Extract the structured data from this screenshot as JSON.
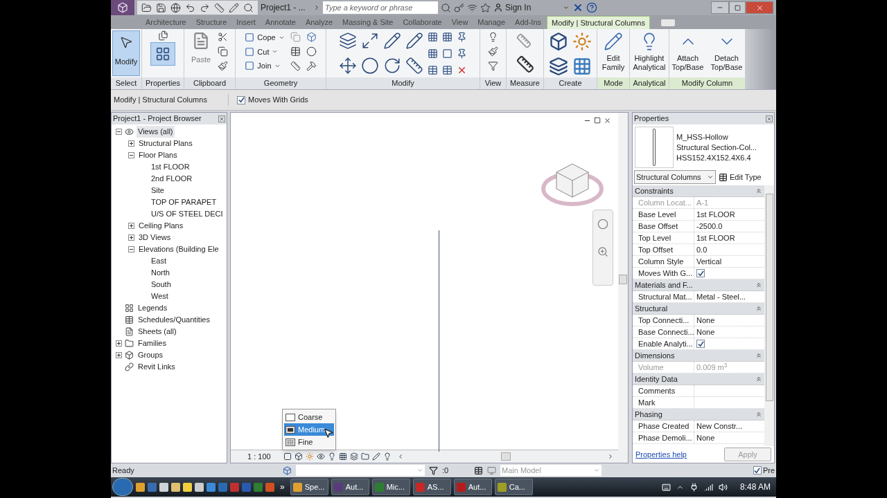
{
  "title_bar": {
    "title": "Project1 - ...",
    "search": {
      "placeholder": "Type a keyword or phrase"
    },
    "sign_in": "Sign In"
  },
  "ribbon_tabs": [
    {
      "label": "Architecture",
      "selected": false
    },
    {
      "label": "Structure",
      "selected": false
    },
    {
      "label": "Insert",
      "selected": false
    },
    {
      "label": "Annotate",
      "selected": false
    },
    {
      "label": "Analyze",
      "selected": false
    },
    {
      "label": "Massing & Site",
      "selected": false
    },
    {
      "label": "Collaborate",
      "selected": false
    },
    {
      "label": "View",
      "selected": false
    },
    {
      "label": "Manage",
      "selected": false
    },
    {
      "label": "Add-Ins",
      "selected": false
    },
    {
      "label": "Modify | Structural Columns",
      "selected": true
    }
  ],
  "ribbon_panels": [
    {
      "kind": "select",
      "label": "Select",
      "contextual": false,
      "buttons": [
        {
          "label": "Modify",
          "selected": true
        }
      ]
    },
    {
      "kind": "properties",
      "label": "Properties",
      "contextual": false,
      "active": true
    },
    {
      "kind": "clipboard",
      "label": "Clipboard",
      "contextual": false,
      "buttons": [
        {
          "label": "Paste",
          "disabled": true
        }
      ]
    },
    {
      "kind": "geometry",
      "label": "Geometry",
      "contextual": false,
      "buttons": [
        {
          "label": "Cope"
        },
        {
          "label": "Cut"
        },
        {
          "label": "Join"
        }
      ]
    },
    {
      "kind": "modify",
      "label": "Modify",
      "contextual": false
    },
    {
      "kind": "view",
      "label": "View",
      "contextual": false
    },
    {
      "kind": "measure",
      "label": "Measure",
      "contextual": false
    },
    {
      "kind": "create",
      "label": "Create",
      "contextual": false
    },
    {
      "kind": "large",
      "label": "Mode",
      "contextual": true,
      "buttons": [
        {
          "label": "Edit Family"
        }
      ]
    },
    {
      "kind": "large",
      "label": "Analytical",
      "contextual": true,
      "buttons": [
        {
          "label": "Highlight Analytical"
        }
      ]
    },
    {
      "kind": "large",
      "label": "Modify Column",
      "contextual": true,
      "buttons": [
        {
          "label": "Attach Top/Base"
        },
        {
          "label": "Detach Top/Base"
        }
      ]
    }
  ],
  "options_bar": {
    "context": "Modify | Structural Columns",
    "moves_with_grids": {
      "label": "Moves With Grids",
      "checked": true
    }
  },
  "project_browser": {
    "title": "Project1 - Project Browser",
    "tree": [
      {
        "label": "Views (all)",
        "kind": "views",
        "expanded": true,
        "selected": true,
        "children": [
          {
            "label": "Structural Plans",
            "expanded": false,
            "selected": false
          },
          {
            "label": "Floor Plans",
            "expanded": true,
            "selected": false,
            "children": [
              {
                "label": "1st FLOOR",
                "selected": false
              },
              {
                "label": "2nd FLOOR",
                "selected": false
              },
              {
                "label": "Site",
                "selected": false
              },
              {
                "label": "TOP OF PARAPET",
                "selected": false
              },
              {
                "label": "U/S OF STEEL DECI",
                "selected": false
              }
            ]
          },
          {
            "label": "Ceiling Plans",
            "expanded": false,
            "selected": false
          },
          {
            "label": "3D Views",
            "expanded": false,
            "selected": false
          },
          {
            "label": "Elevations (Building Ele",
            "expanded": true,
            "selected": false,
            "children": [
              {
                "label": "East",
                "selected": false
              },
              {
                "label": "North",
                "selected": false
              },
              {
                "label": "South",
                "selected": false
              },
              {
                "label": "West",
                "selected": false
              }
            ]
          }
        ]
      },
      {
        "label": "Legends",
        "kind": "legends",
        "selected": false
      },
      {
        "label": "Schedules/Quantities",
        "kind": "schedules",
        "selected": false
      },
      {
        "label": "Sheets (all)",
        "kind": "sheets",
        "selected": false
      },
      {
        "label": "Families",
        "kind": "families",
        "expanded": false,
        "selected": false
      },
      {
        "label": "Groups",
        "kind": "groups",
        "expanded": false,
        "selected": false
      },
      {
        "label": "Revit Links",
        "kind": "links",
        "selected": false
      }
    ]
  },
  "view": {
    "scale": "1 : 100",
    "detail_menu": [
      {
        "label": "Coarse",
        "kind": "coarse",
        "selected": false
      },
      {
        "label": "Medium",
        "kind": "medium",
        "selected": true
      },
      {
        "label": "Fine",
        "kind": "fine",
        "selected": false
      }
    ]
  },
  "properties": {
    "title": "Properties",
    "type_lines": [
      "M_HSS-Hollow",
      "Structural Section-Col...",
      "HSS152.4X152.4X6.4"
    ],
    "category": "Structural Columns",
    "edit_type": "Edit Type",
    "groups": [
      {
        "name": "Constraints",
        "rows": [
          {
            "label": "Column Locat...",
            "value": "A-1",
            "kind": "text",
            "readonly": true
          },
          {
            "label": "Base Level",
            "value": "1st FLOOR",
            "kind": "text",
            "readonly": false
          },
          {
            "label": "Base Offset",
            "value": "-2500.0",
            "kind": "text",
            "readonly": false
          },
          {
            "label": "Top Level",
            "value": "1st FLOOR",
            "kind": "text",
            "readonly": false
          },
          {
            "label": "Top Offset",
            "value": "0.0",
            "kind": "text",
            "readonly": false
          },
          {
            "label": "Column Style",
            "value": "Vertical",
            "kind": "text",
            "readonly": false
          },
          {
            "label": "Moves With G...",
            "kind": "check",
            "checked": true,
            "readonly": false
          }
        ]
      },
      {
        "name": "Materials and F...",
        "rows": [
          {
            "label": "Structural Mat...",
            "value": "Metal - Steel...",
            "kind": "text",
            "readonly": false
          }
        ]
      },
      {
        "name": "Structural",
        "rows": [
          {
            "label": "Top Connecti...",
            "value": "None",
            "kind": "text",
            "readonly": false
          },
          {
            "label": "Base Connecti...",
            "value": "None",
            "kind": "text",
            "readonly": false
          },
          {
            "label": "Enable Analyti...",
            "kind": "check",
            "checked": true,
            "readonly": false
          }
        ]
      },
      {
        "name": "Dimensions",
        "rows": [
          {
            "label": "Volume",
            "value": "0.009 m$^{3}$",
            "kind": "text",
            "readonly": true
          }
        ]
      },
      {
        "name": "Identity Data",
        "rows": [
          {
            "label": "Comments",
            "kind": "text",
            "readonly": false
          },
          {
            "label": "Mark",
            "kind": "text",
            "readonly": false
          }
        ]
      },
      {
        "name": "Phasing",
        "rows": [
          {
            "label": "Phase Created",
            "value": "New Constr...",
            "kind": "text",
            "readonly": false
          },
          {
            "label": "Phase Demoli...",
            "value": "None",
            "kind": "text",
            "readonly": false
          }
        ]
      }
    ],
    "help": "Properties help",
    "apply": {
      "label": "Apply",
      "disabled": true
    }
  },
  "status_bar": {
    "text": "Ready",
    "filter_count": ":0",
    "workset": "Main Model",
    "press_drag": {
      "label": "Pre",
      "checked": true
    }
  },
  "taskbar": {
    "buttons": [
      {
        "label": "Spe...",
        "color": "#e0a030"
      },
      {
        "label": "Aut...",
        "color": "#5a3a7a"
      },
      {
        "label": "Mic...",
        "color": "#2e7d32"
      },
      {
        "label": "AS...",
        "color": "#c62828"
      },
      {
        "label": "Aut...",
        "color": "#b71c1c"
      },
      {
        "label": "Ca...",
        "color": "#9e9d24"
      }
    ],
    "overflow": "»",
    "time": "8:48 AM"
  }
}
